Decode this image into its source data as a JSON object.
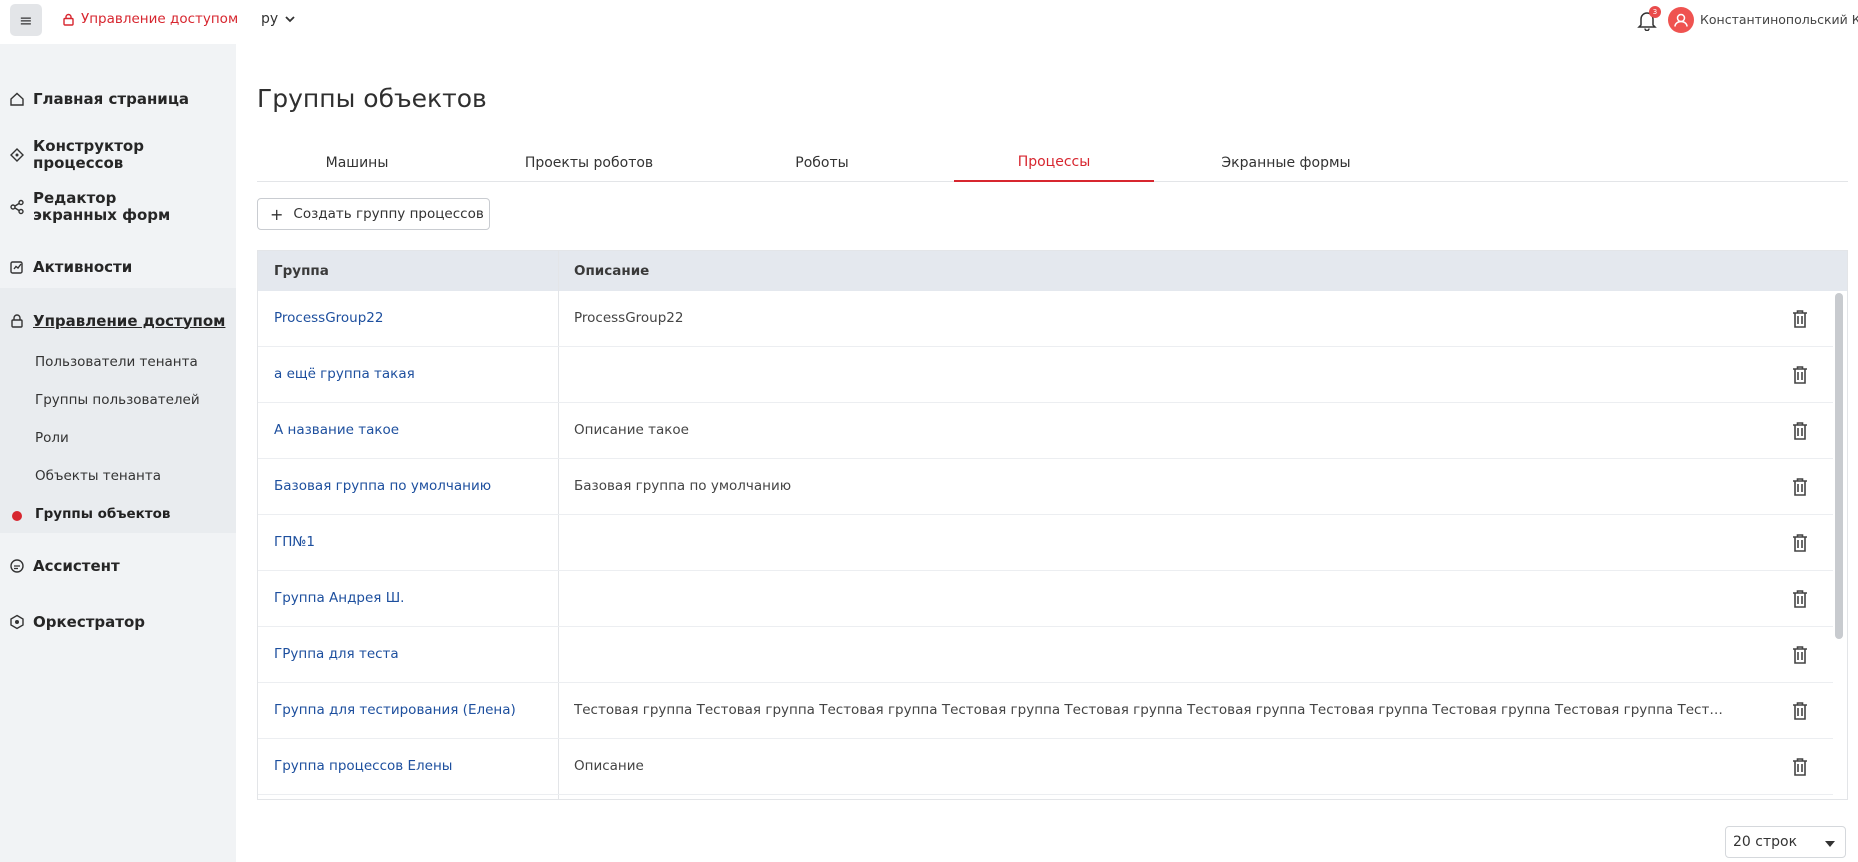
{
  "header": {
    "menu_icon": "menu-icon",
    "brand_label": "Управление доступом",
    "lang": "ру",
    "notifications_count": "3",
    "user_name": "Константинопольский К."
  },
  "sidebar": {
    "items": [
      {
        "label": "Главная страница",
        "icon": "home-icon"
      },
      {
        "label": "Конструктор процессов",
        "icon": "process-icon"
      },
      {
        "label": "Редактор экранных форм",
        "icon": "forms-icon"
      },
      {
        "label": "Активности",
        "icon": "activity-icon"
      },
      {
        "label": "Управление доступом",
        "icon": "access-icon"
      },
      {
        "label": "Ассистент",
        "icon": "assistant-icon"
      },
      {
        "label": "Оркестратор",
        "icon": "orchestrator-icon"
      }
    ],
    "sub_items": [
      {
        "label": "Пользователи тенанта"
      },
      {
        "label": "Группы пользователей"
      },
      {
        "label": "Роли"
      },
      {
        "label": "Объекты тенанта"
      },
      {
        "label": "Группы объектов"
      }
    ]
  },
  "main": {
    "title": "Группы объектов",
    "tabs": [
      {
        "label": "Машины"
      },
      {
        "label": "Проекты роботов"
      },
      {
        "label": "Роботы"
      },
      {
        "label": "Процессы"
      },
      {
        "label": "Экранные формы"
      }
    ],
    "active_tab": "Процессы",
    "create_button": "Создать группу процессов",
    "table": {
      "columns": [
        "Группа",
        "Описание"
      ],
      "rows": [
        {
          "name": "ProcessGroup22",
          "desc": "ProcessGroup22"
        },
        {
          "name": "а ещё группа такая",
          "desc": ""
        },
        {
          "name": "А название такое",
          "desc": "Описание такое"
        },
        {
          "name": "Базовая группа по умолчанию",
          "desc": "Базовая группа по умолчанию"
        },
        {
          "name": "ГП№1",
          "desc": ""
        },
        {
          "name": "Группа Андрея Ш.",
          "desc": ""
        },
        {
          "name": "ГРуппа для теста",
          "desc": ""
        },
        {
          "name": "Группа для тестирования (Елена)",
          "desc": "Тестовая группа Тестовая группа Тестовая группа Тестовая группа Тестовая группа Тестовая группа Тестовая группа Тестовая группа Тестовая группа Тестовая групп..."
        },
        {
          "name": "Группа процессов Елены",
          "desc": "Описание"
        }
      ]
    },
    "pager_label": "20 строк"
  },
  "colors": {
    "accent": "#d7262f",
    "link": "#1d4f9e",
    "sidebar_bg": "#f1f3f5",
    "table_header_bg": "#e4e8ee"
  }
}
